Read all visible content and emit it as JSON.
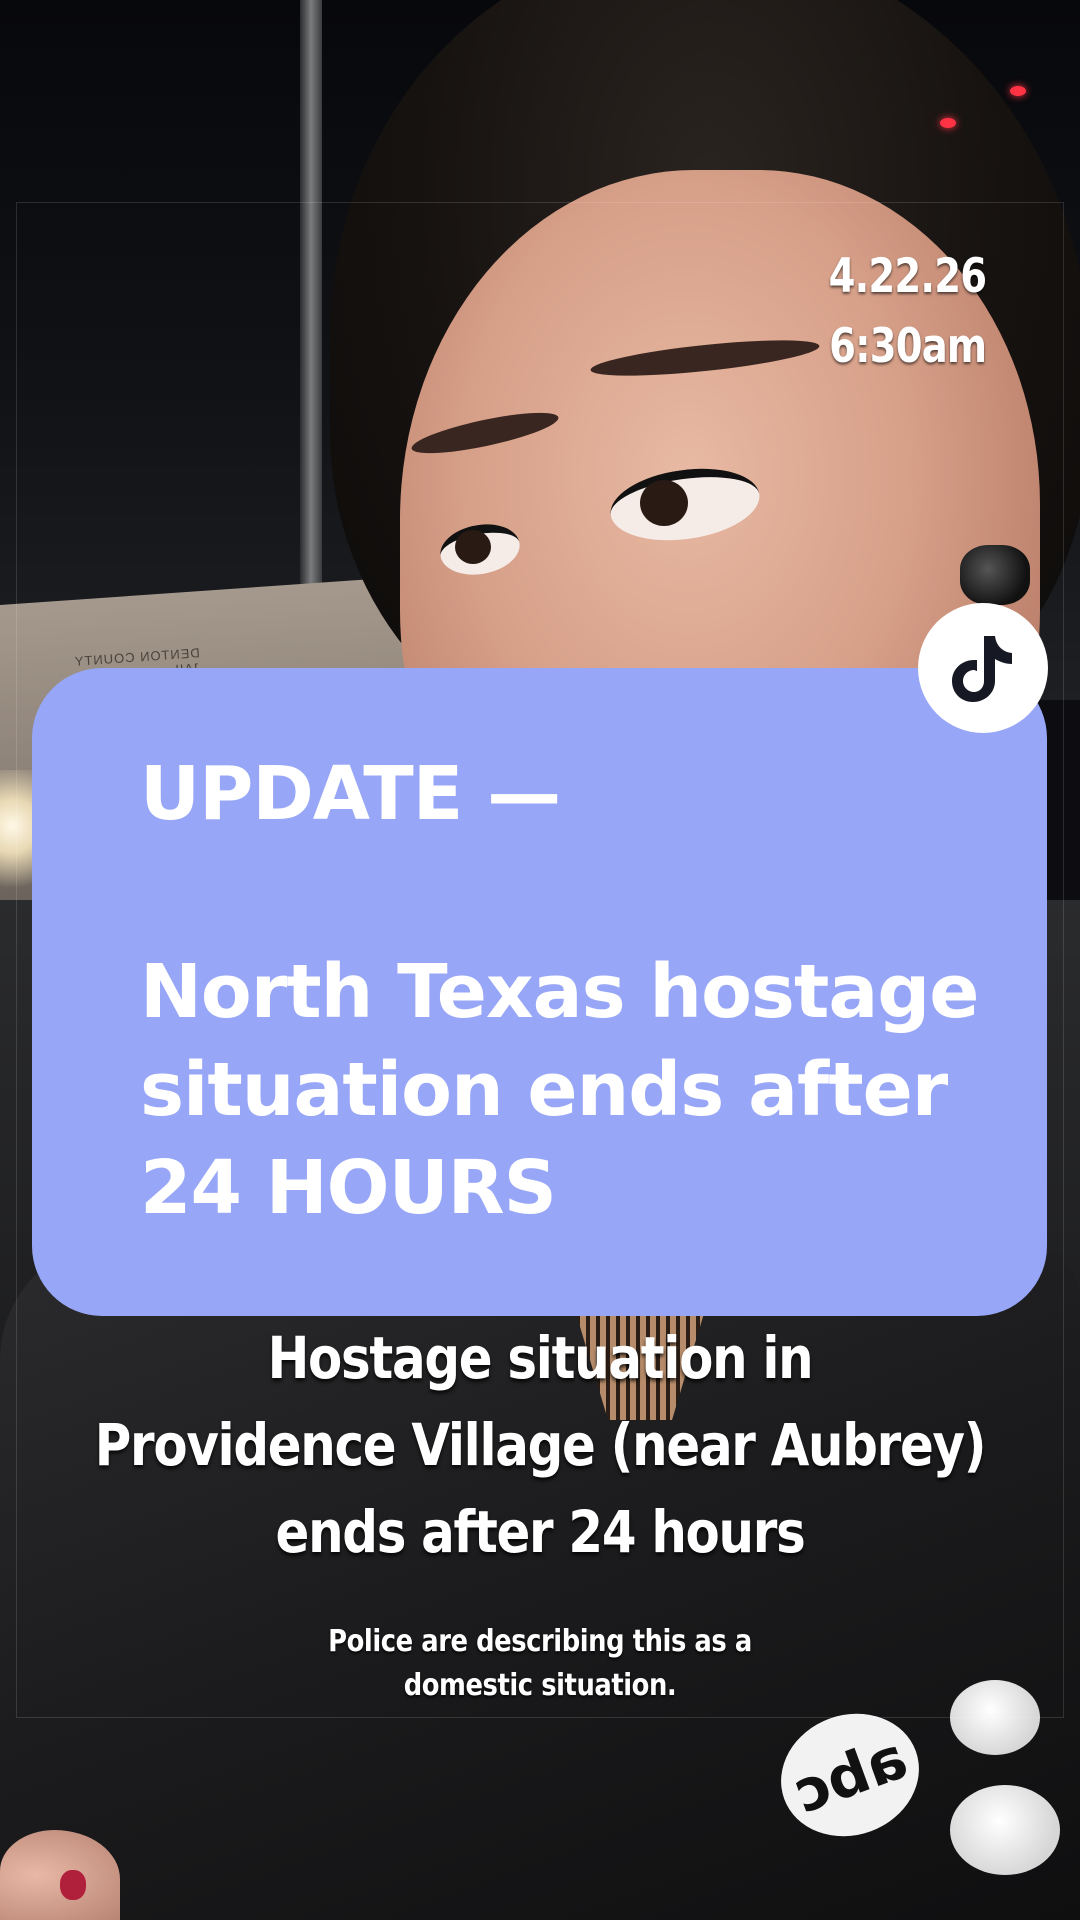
{
  "overlay": {
    "date": "4.22.26",
    "time": "6:30am"
  },
  "card": {
    "color": "#97a6f7",
    "kicker": "UPDATE —",
    "headline_lines": [
      "North Texas hostage",
      "situation ends after",
      "24 HOURS"
    ]
  },
  "badge": {
    "icon": "tiktok-icon"
  },
  "caption": {
    "lines": [
      "Hostage situation in",
      "Providence Village (near Aubrey)",
      "ends after 24 hours"
    ]
  },
  "subcaption": {
    "lines": [
      "Police are describing this as a",
      "domestic situation."
    ]
  },
  "scene": {
    "building_sign": "DENTON COUNTY JAIL",
    "jacket_logo": "abc"
  }
}
